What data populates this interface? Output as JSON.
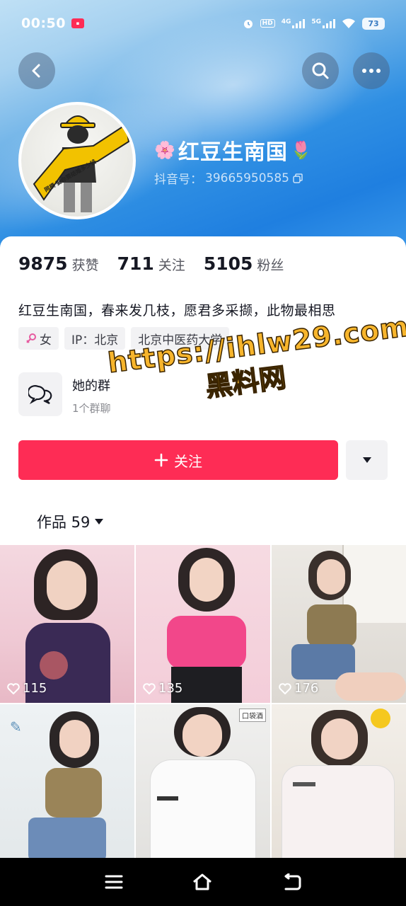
{
  "status_bar": {
    "time": "00:50",
    "network_labels": [
      "HD",
      "4G",
      "5G"
    ],
    "battery": "73"
  },
  "header": {
    "back_icon": "chevron-left-icon",
    "search_icon": "search-icon",
    "more_icon": "more-dots-icon"
  },
  "profile": {
    "nickname": "红豆生南国",
    "prefix_emoji": "🌸",
    "suffix_emoji": "🌷",
    "douyin_id_label": "抖音号：",
    "douyin_id": "39665950585",
    "avatar_caption": "网模 娶你要结婚多少钱"
  },
  "stats": [
    {
      "value": "9875",
      "label": "获赞"
    },
    {
      "value": "711",
      "label": "关注"
    },
    {
      "value": "5105",
      "label": "粉丝"
    }
  ],
  "bio": "红豆生南国，春来发几枝，愿君多采撷，此物最相思",
  "tags": {
    "gender": "女",
    "ip": "IP：北京",
    "school": "北京中医药大学"
  },
  "group": {
    "title": "她的群",
    "count": "1个群聊"
  },
  "watermark": {
    "line1": "https://ihlw29.com",
    "line2": "黑料网"
  },
  "follow_button": {
    "label": "关注",
    "icon": "plus-icon"
  },
  "works_tab": {
    "label": "作品 59"
  },
  "grid": {
    "likes": [
      "115",
      "135",
      "176",
      "",
      "",
      ""
    ],
    "thumb_caption_5": "口袋酒"
  },
  "colors": {
    "accent": "#fe2c55",
    "hero_blue": "#2f8fe3",
    "watermark": "#f7b52c"
  }
}
